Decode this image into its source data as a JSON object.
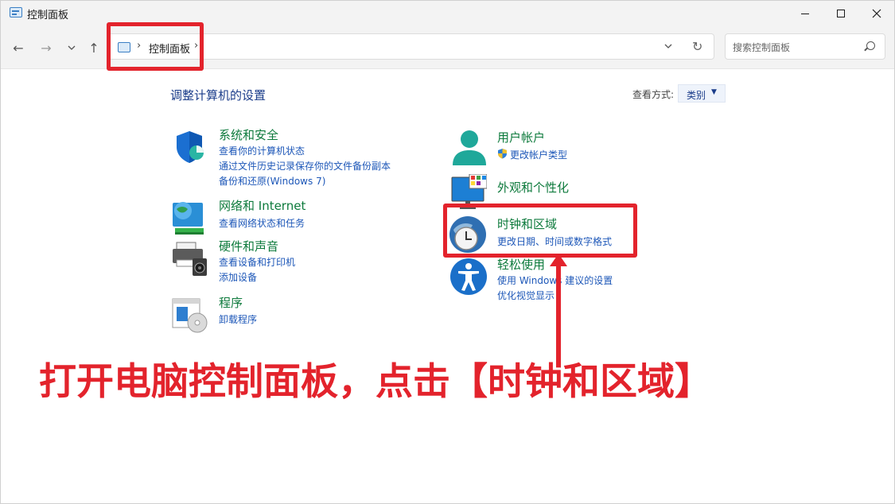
{
  "window": {
    "title": "控制面板",
    "icon": "control-panel-icon",
    "buttons": {
      "minimize": "—",
      "maximize": "☐",
      "close": "✕"
    }
  },
  "nav": {
    "back": "←",
    "forward": "→",
    "recent": "⌄",
    "up": "↑",
    "address": {
      "icon": "control-panel-icon",
      "sep1": "›",
      "text": "控制面板",
      "sep2": "›",
      "dropdown": "⌄",
      "refresh": "↻"
    },
    "search": {
      "placeholder": "搜索控制面板",
      "icon": "search-icon"
    }
  },
  "main": {
    "heading": "调整计算机的设置",
    "view_by": {
      "label": "查看方式:",
      "value": "类别",
      "caret": "▼"
    },
    "categories": [
      {
        "title": "系统和安全",
        "icon": "shield-icon",
        "links": [
          "查看你的计算机状态",
          "通过文件历史记录保存你的文件备份副本",
          "备份和还原(Windows 7)"
        ]
      },
      {
        "title": "网络和 Internet",
        "icon": "network-globe-icon",
        "links": [
          "查看网络状态和任务"
        ]
      },
      {
        "title": "硬件和声音",
        "icon": "printer-speaker-icon",
        "links": [
          "查看设备和打印机",
          "添加设备"
        ]
      },
      {
        "title": "程序",
        "icon": "programs-disc-icon",
        "links": [
          "卸载程序"
        ]
      },
      {
        "title": "用户帐户",
        "icon": "user-icon",
        "links": [
          "更改帐户类型"
        ]
      },
      {
        "title": "外观和个性化",
        "icon": "monitor-icon",
        "links": []
      },
      {
        "title": "时钟和区域",
        "icon": "clock-globe-icon",
        "links": [
          "更改日期、时间或数字格式"
        ]
      },
      {
        "title": "轻松使用",
        "icon": "accessibility-icon",
        "links": [
          "使用 Windows 建议的设置",
          "优化视觉显示"
        ]
      }
    ]
  },
  "annotation": {
    "callout": "打开电脑控制面板，点击【时钟和区域】",
    "color": "#e3232c"
  }
}
